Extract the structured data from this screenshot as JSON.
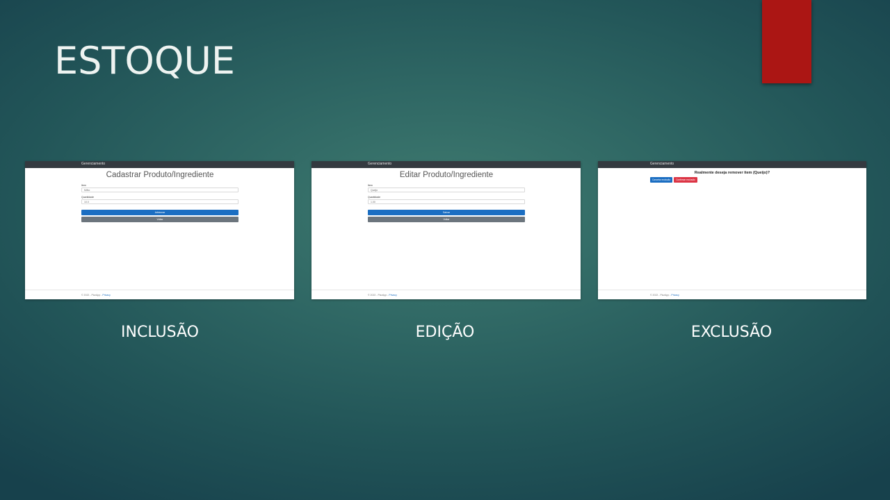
{
  "slide": {
    "title": "ESTOQUE",
    "accent_color": "#ab1614"
  },
  "screens": [
    {
      "caption": "INCLUSÃO",
      "nav_brand": "Gerenciamento",
      "form_title": "Cadastrar Produto/Ingrediente",
      "fields": [
        {
          "label": "Item",
          "value": "Milho"
        },
        {
          "label": "Quantidade",
          "value": "10.0"
        }
      ],
      "primary_button": "Adicionar",
      "secondary_button": "Voltar",
      "footer_text": "© 2022 - PizzApp - ",
      "footer_link": "Privacy"
    },
    {
      "caption": "EDIÇÃO",
      "nav_brand": "Gerenciamento",
      "form_title": "Editar Produto/Ingrediente",
      "fields": [
        {
          "label": "Item",
          "value": "Queijo"
        },
        {
          "label": "Quantidade",
          "value": "1.00"
        }
      ],
      "primary_button": "Salvar",
      "secondary_button": "Voltar",
      "footer_text": "© 2022 - PizzApp - ",
      "footer_link": "Privacy"
    },
    {
      "caption": "EXCLUSÃO",
      "nav_brand": "Gerenciamento",
      "question": "Realmente deseja remover item (Queijo)?",
      "cancel_button": "Cancelar exclusão",
      "confirm_button": "Confirmar exclusão",
      "footer_text": "© 2022 - PizzApp - ",
      "footer_link": "Privacy"
    }
  ],
  "colors": {
    "nav": "#343a40",
    "primary": "#1b6ec2",
    "secondary": "#6c757d",
    "danger": "#dc3545"
  }
}
